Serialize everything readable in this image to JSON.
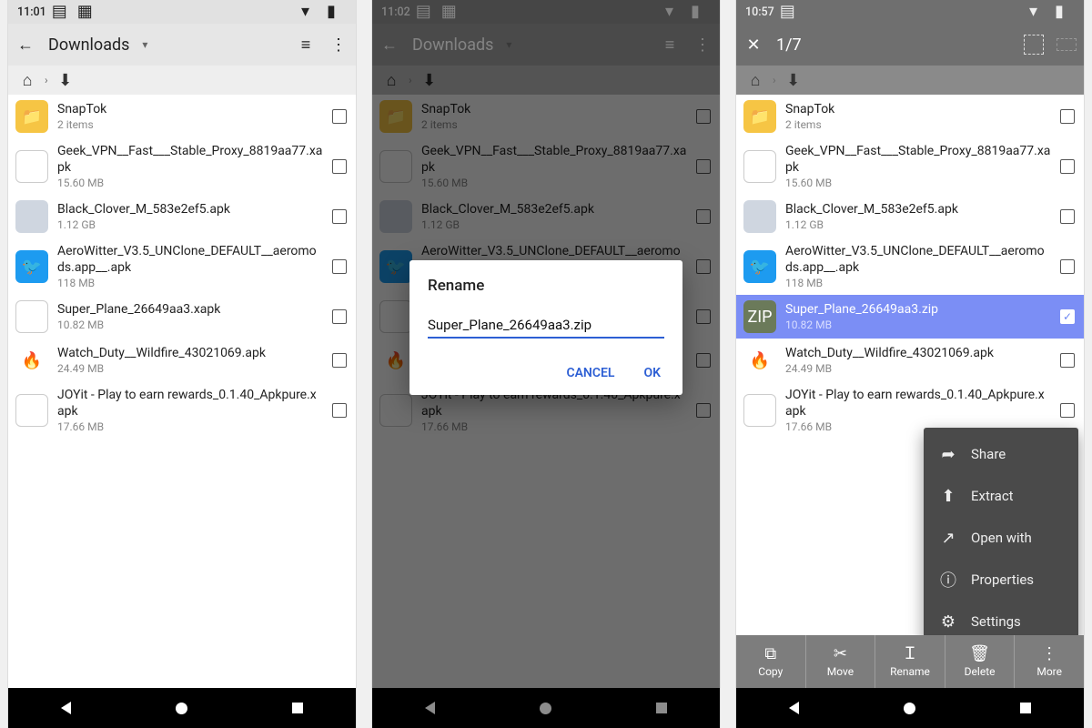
{
  "screens": [
    {
      "status": {
        "time": "11:01",
        "icons": [
          "sd",
          "app"
        ],
        "right": [
          "wifi",
          "batt"
        ]
      },
      "toolbar": {
        "back": "←",
        "title": "Downloads",
        "dropdown": "▾",
        "view": "list",
        "menu": "⋮"
      },
      "breadcrumb": {
        "home": "⌂",
        "sep": "›",
        "download": "↓"
      },
      "files": [
        {
          "icon": "folder",
          "name": "SnapTok",
          "sub": "2 items"
        },
        {
          "icon": "blank",
          "name": "Geek_VPN__Fast___Stable_Proxy_8819aa77.xapk",
          "sub": "15.60 MB"
        },
        {
          "icon": "avatar",
          "name": "Black_Clover_M_583e2ef5.apk",
          "sub": "1.12 GB"
        },
        {
          "icon": "twitter",
          "name": "AeroWitter_V3.5_UNClone_DEFAULT__aeromods.app__.apk",
          "sub": "118 MB"
        },
        {
          "icon": "blank",
          "name": "Super_Plane_26649aa3.xapk",
          "sub": "10.82 MB"
        },
        {
          "icon": "fire",
          "name": "Watch_Duty__Wildfire_43021069.apk",
          "sub": "24.49 MB"
        },
        {
          "icon": "blank",
          "name": "JOYit - Play to earn rewards_0.1.40_Apkpure.xapk",
          "sub": "17.66 MB"
        }
      ]
    },
    {
      "status": {
        "time": "11:02"
      },
      "toolbar": {
        "title": "Downloads"
      },
      "dialog": {
        "title": "Rename",
        "value": "Super_Plane_26649aa3.zip",
        "cancel": "CANCEL",
        "ok": "OK"
      },
      "files_same_as_screen0": true
    },
    {
      "status": {
        "time": "10:57"
      },
      "toolbar": {
        "close": "✕",
        "count": "1/7"
      },
      "files": [
        {
          "icon": "folder",
          "name": "SnapTok",
          "sub": "2 items"
        },
        {
          "icon": "blank",
          "name": "Geek_VPN__Fast___Stable_Proxy_8819aa77.xapk",
          "sub": "15.60 MB"
        },
        {
          "icon": "avatar",
          "name": "Black_Clover_M_583e2ef5.apk",
          "sub": "1.12 GB"
        },
        {
          "icon": "twitter",
          "name": "AeroWitter_V3.5_UNClone_DEFAULT__aeromods.app__.apk",
          "sub": "118 MB"
        },
        {
          "icon": "zip",
          "name": "Super_Plane_26649aa3.zip",
          "sub": "10.82 MB",
          "selected": true
        },
        {
          "icon": "fire",
          "name": "Watch_Duty__Wildfire_43021069.apk",
          "sub": "24.49 MB"
        },
        {
          "icon": "blank",
          "name": "JOYit - Play to earn rewards_0.1.40_Apkpure.xapk",
          "sub": "17.66 MB"
        }
      ],
      "popup": [
        {
          "icon": "share",
          "label": "Share"
        },
        {
          "icon": "extract",
          "label": "Extract"
        },
        {
          "icon": "openwith",
          "label": "Open with"
        },
        {
          "icon": "properties",
          "label": "Properties"
        },
        {
          "icon": "settings",
          "label": "Settings"
        }
      ],
      "actionbar": [
        {
          "icon": "copy",
          "label": "Copy"
        },
        {
          "icon": "move",
          "label": "Move"
        },
        {
          "icon": "rename",
          "label": "Rename"
        },
        {
          "icon": "delete",
          "label": "Delete"
        },
        {
          "icon": "more",
          "label": "More"
        }
      ]
    }
  ],
  "icon_glyphs": {
    "folder": "📁",
    "twitter": "🐦",
    "fire": "🔥",
    "zip": "ZIP",
    "share": "➦",
    "extract": "⬆",
    "openwith": "↗",
    "properties": "ⓘ",
    "settings": "⚙",
    "copy": "⧉",
    "move": "✂",
    "rename": "Ｉ",
    "delete": "🗑",
    "more": "⋮",
    "list": "≡",
    "menu": "⋮",
    "back": "←",
    "close": "✕",
    "home": "⌂",
    "download": "⬇",
    "chev": "›",
    "wifi": "▾",
    "batt": "▮",
    "sd": "▤",
    "app": "▦",
    "dropdown": "▾",
    "selectall": "▦",
    "selectinv": "▥"
  }
}
